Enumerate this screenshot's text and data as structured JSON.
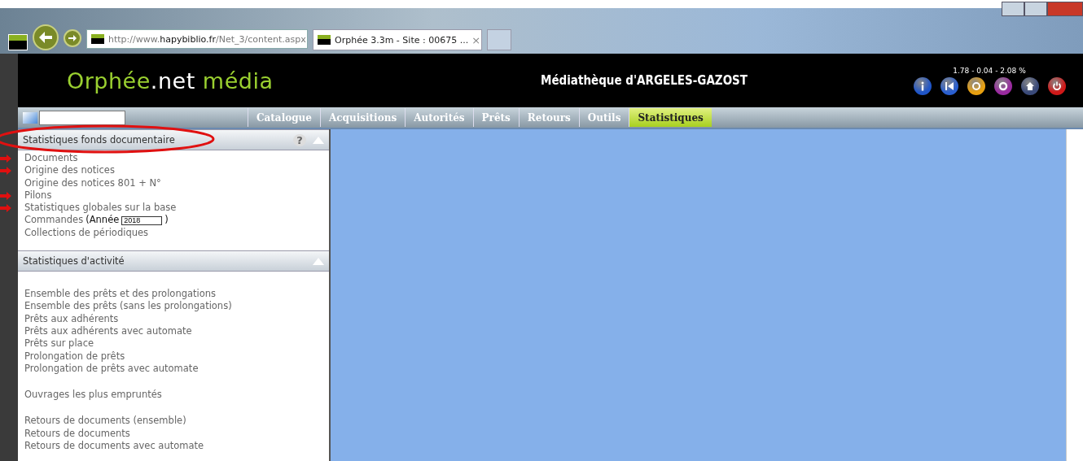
{
  "browser": {
    "address": {
      "prefix": "http://www.",
      "domain": "hapybiblio.fr",
      "path": "/Net_3/content.aspx"
    },
    "tab": {
      "title": "Orphée 3.3m - Site : 00675 ...",
      "close": "×"
    }
  },
  "header": {
    "logo": {
      "main": "Orphée",
      "dot": ".",
      "net": "net",
      "media": "média"
    },
    "title": "Médiathèque d'ARGELES-GAZOST",
    "stats": "1.78 - 0.04 - 2.08 %",
    "buttons": [
      {
        "kind": "info",
        "color": "#1f55c8"
      },
      {
        "kind": "first",
        "color": "#2a5fd0"
      },
      {
        "kind": "refresh",
        "color": "#e8a010"
      },
      {
        "kind": "ring",
        "color": "#9a2aa0"
      },
      {
        "kind": "home",
        "color": "#3a4a7a"
      },
      {
        "kind": "power",
        "color": "#d01818"
      }
    ]
  },
  "nav": {
    "tabs": [
      {
        "label": "Catalogue",
        "selected": false
      },
      {
        "label": "Acquisitions",
        "selected": false
      },
      {
        "label": "Autorités",
        "selected": false
      },
      {
        "label": "Prêts",
        "selected": false
      },
      {
        "label": "Retours",
        "selected": false
      },
      {
        "label": "Outils",
        "selected": false
      },
      {
        "label": "Statistiques",
        "selected": true
      }
    ]
  },
  "panels": [
    {
      "title": "Statistiques fonds documentaire",
      "help": "?",
      "expanded": true,
      "highlighted": true,
      "groups": [
        [
          {
            "kind": "link",
            "label": "Documents",
            "marked": true
          },
          {
            "kind": "link",
            "label": "Origine des notices",
            "marked": true
          },
          {
            "kind": "link",
            "label": "Origine des notices 801 + N°",
            "marked": false
          },
          {
            "kind": "link",
            "label": "Pilons",
            "marked": true
          },
          {
            "kind": "link",
            "label": "Statistiques globales sur la base",
            "marked": true
          },
          {
            "kind": "year",
            "label": "Commandes",
            "open": "(",
            "year_label": "Année",
            "year": "2018",
            "close": ")",
            "marked": false
          },
          {
            "kind": "link",
            "label": "Collections de périodiques",
            "marked": false
          }
        ]
      ]
    },
    {
      "title": "Statistiques d'activité",
      "expanded": true,
      "highlighted": false,
      "groups": [
        [
          {
            "kind": "link",
            "label": "Ensemble des prêts et des prolongations",
            "marked": false
          },
          {
            "kind": "link",
            "label": "Ensemble des prêts (sans les prolongations)",
            "marked": false
          },
          {
            "kind": "link",
            "label": "Prêts aux adhérents",
            "marked": false
          },
          {
            "kind": "link",
            "label": "Prêts aux adhérents avec automate",
            "marked": false
          },
          {
            "kind": "link",
            "label": "Prêts sur place",
            "marked": false
          },
          {
            "kind": "link",
            "label": "Prolongation de prêts",
            "marked": false
          },
          {
            "kind": "link",
            "label": "Prolongation de prêts avec automate",
            "marked": false
          }
        ],
        [
          {
            "kind": "link",
            "label": "Ouvrages les plus empruntés",
            "marked": false
          }
        ],
        [
          {
            "kind": "link",
            "label": "Retours de documents (ensemble)",
            "marked": false
          },
          {
            "kind": "link",
            "label": "Retours de documents",
            "marked": false
          },
          {
            "kind": "link",
            "label": "Retours de documents avec automate",
            "marked": false
          }
        ]
      ]
    }
  ]
}
